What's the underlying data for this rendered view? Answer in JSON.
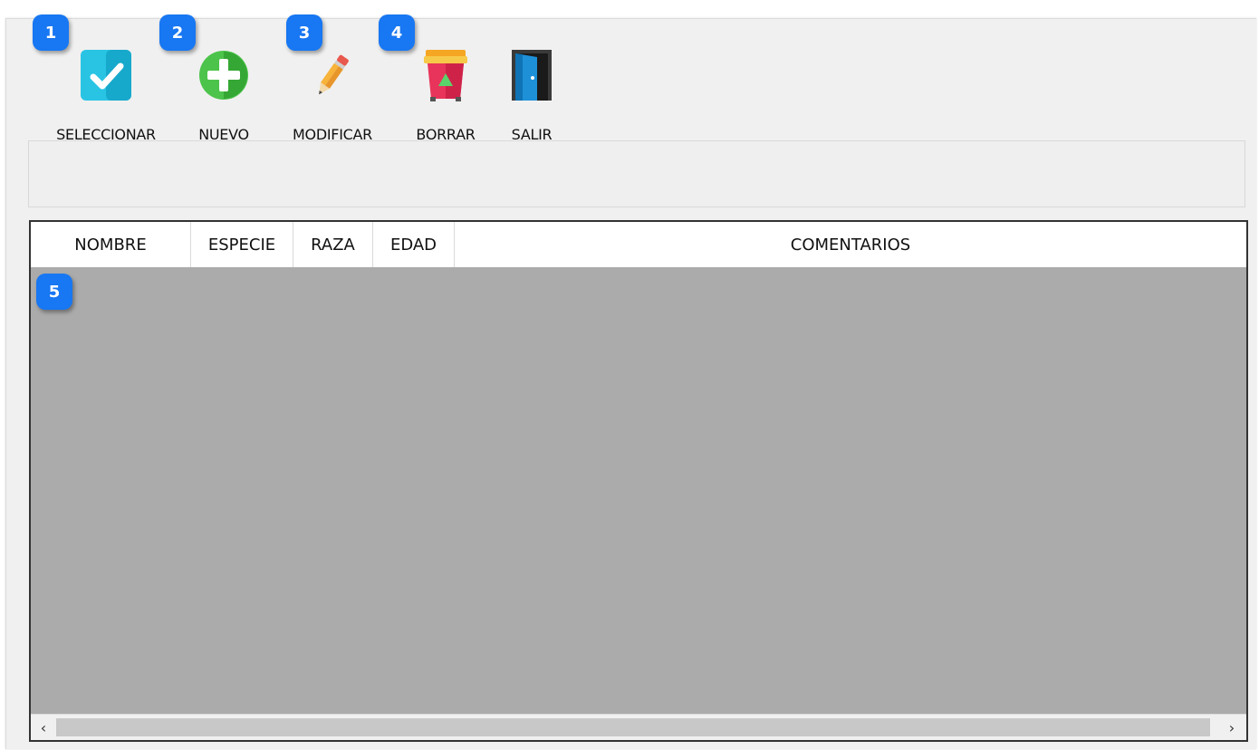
{
  "toolbar": {
    "buttons": [
      {
        "label": "SELECCIONAR",
        "icon": "check-icon"
      },
      {
        "label": "NUEVO",
        "icon": "add-icon"
      },
      {
        "label": "MODIFICAR",
        "icon": "pencil-icon"
      },
      {
        "label": "BORRAR",
        "icon": "trash-icon"
      },
      {
        "label": "SALIR",
        "icon": "exit-door-icon"
      }
    ]
  },
  "badges": [
    "1",
    "2",
    "3",
    "4",
    "5"
  ],
  "grid": {
    "columns": [
      "NOMBRE",
      "ESPECIE",
      "RAZA",
      "EDAD",
      "COMENTARIOS"
    ]
  },
  "scrollbar": {
    "left_arrow": "‹",
    "right_arrow": "›"
  },
  "colors": {
    "badge": "#1877f2",
    "grid_body": "#ababab"
  }
}
